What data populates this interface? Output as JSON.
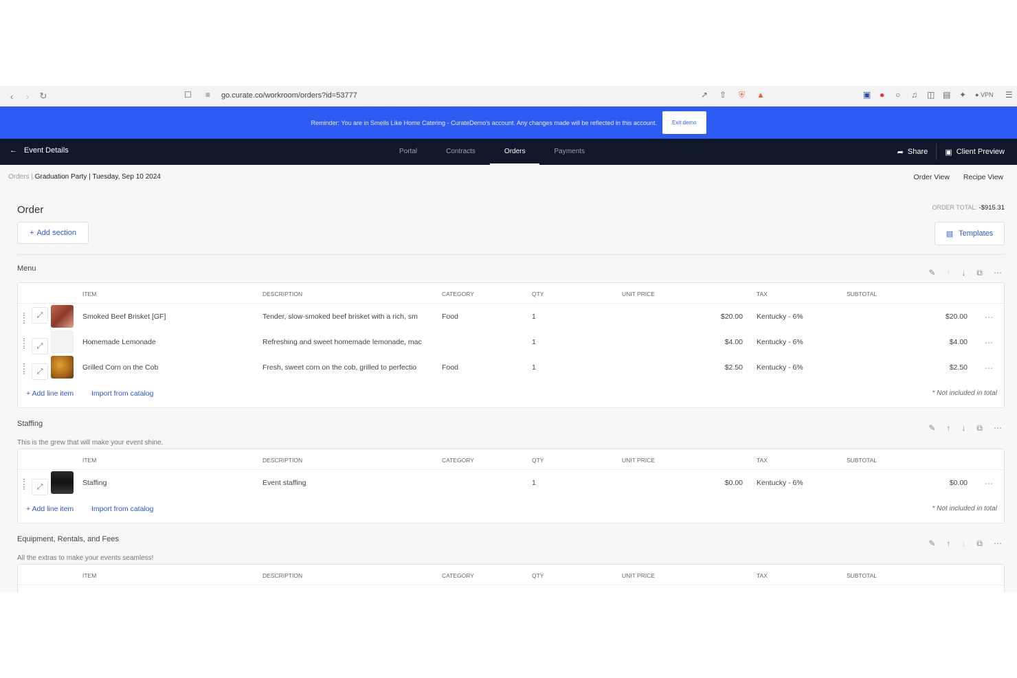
{
  "browser": {
    "url": "go.curate.co/workroom/orders?id=53777",
    "vpn_label": "VPN"
  },
  "banner": {
    "text": "Reminder: You are in Smells Like Home Catering - CurateDemo's account. Any changes made will be reflected in this account.",
    "exit_label": "Exit demo"
  },
  "appnav": {
    "back_label": "Event Details",
    "tabs": [
      "Portal",
      "Contracts",
      "Orders",
      "Payments"
    ],
    "active_tab": "Orders",
    "share_label": "Share",
    "client_preview_label": "Client Preview"
  },
  "breadcrumb": {
    "root": "Orders",
    "event": "Graduation Party",
    "date": "Tuesday, Sep 10 2024"
  },
  "views": {
    "order_view": "Order View",
    "recipe_view": "Recipe View"
  },
  "order": {
    "title": "Order",
    "total_label": "ORDER TOTAL:",
    "total_value": "-$915.31",
    "add_section_label": "Add section",
    "templates_label": "Templates"
  },
  "columns": [
    "ITEM",
    "DESCRIPTION",
    "CATEGORY",
    "QTY",
    "UNIT PRICE",
    "TAX",
    "SUBTOTAL"
  ],
  "footer": {
    "add_line_item": "Add line item",
    "import_catalog": "Import from catalog",
    "not_included": "* Not included in total"
  },
  "sections": [
    {
      "title": "Menu",
      "description": "",
      "rows": [
        {
          "item": "Smoked Beef Brisket [GF]",
          "description": "Tender, slow-smoked beef brisket with a rich, sm",
          "category": "Food",
          "qty": "1",
          "unit_price": "$20.00",
          "tax": "Kentucky - 6%",
          "subtotal": "$20.00"
        },
        {
          "item": "Homemade Lemonade",
          "description": "Refreshing and sweet homemade lemonade, mac",
          "category": "",
          "qty": "1",
          "unit_price": "$4.00",
          "tax": "Kentucky - 6%",
          "subtotal": "$4.00"
        },
        {
          "item": "Grilled Corn on the Cob",
          "description": "Fresh, sweet corn on the cob, grilled to perfectio",
          "category": "Food",
          "qty": "1",
          "unit_price": "$2.50",
          "tax": "Kentucky - 6%",
          "subtotal": "$2.50"
        }
      ]
    },
    {
      "title": "Staffing",
      "description": "This is the grew that will make your event shine.",
      "rows": [
        {
          "item": "Staffing",
          "description": "Event staffing",
          "category": "",
          "qty": "1",
          "unit_price": "$0.00",
          "tax": "Kentucky - 6%",
          "subtotal": "$0.00"
        }
      ]
    },
    {
      "title": "Equipment, Rentals, and Fees",
      "description": "All the extras to make your events seamless!",
      "rows": []
    }
  ]
}
